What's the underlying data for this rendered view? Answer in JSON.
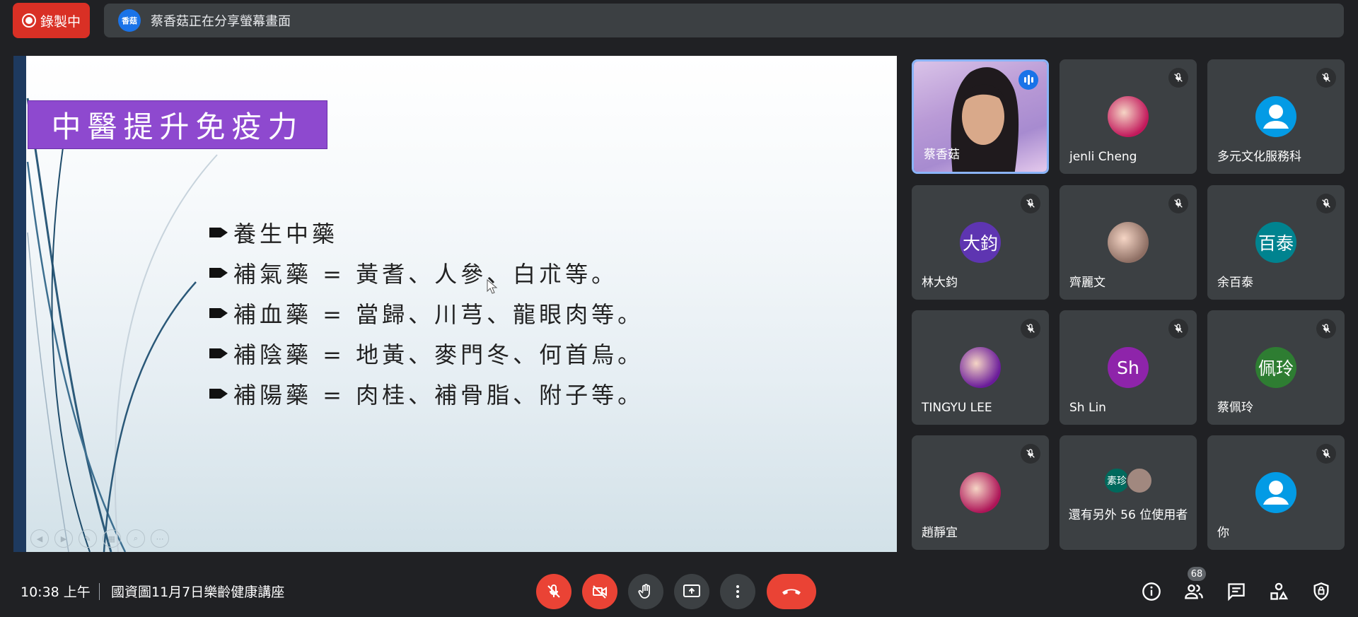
{
  "recording": {
    "label": "錄製中"
  },
  "share_bar": {
    "avatar_text": "香菇",
    "text": "蔡香菇正在分享螢幕畫面"
  },
  "slide": {
    "title": "中醫提升免疫力",
    "bullets": [
      "養生中藥",
      "補氣藥 = 黃耆、人參、白朮等。",
      "補血藥 = 當歸、川芎、龍眼肉等。",
      "補陰藥 = 地黃、麥門冬、何首烏。",
      "補陽藥 = 肉桂、補骨脂、附子等。"
    ]
  },
  "participants": [
    {
      "name": "蔡香菇",
      "state": "speaking",
      "kind": "video"
    },
    {
      "name": "jenli Cheng",
      "state": "muted",
      "kind": "photo",
      "color": "#c2185b"
    },
    {
      "name": "多元文化服務科",
      "state": "muted",
      "kind": "default",
      "color": "#039be5"
    },
    {
      "name": "林大鈞",
      "state": "muted",
      "kind": "letter",
      "letter": "大鈞",
      "color": "#5e35b1"
    },
    {
      "name": "齊麗文",
      "state": "muted",
      "kind": "photo",
      "color": "#8d6e63"
    },
    {
      "name": "余百泰",
      "state": "muted",
      "kind": "letter",
      "letter": "百泰",
      "color": "#00838f"
    },
    {
      "name": "TINGYU LEE",
      "state": "muted",
      "kind": "photo",
      "color": "#6a1b9a"
    },
    {
      "name": "Sh Lin",
      "state": "muted",
      "kind": "letter",
      "letter": "Sh",
      "color": "#8e24aa"
    },
    {
      "name": "蔡佩玲",
      "state": "muted",
      "kind": "letter",
      "letter": "佩玲",
      "color": "#2e7d32"
    },
    {
      "name": "趙靜宜",
      "state": "muted",
      "kind": "photo",
      "color": "#ad1457"
    },
    {
      "name": "還有另外 56 位使用者",
      "state": "none",
      "kind": "more",
      "letter": "素珍",
      "color": "#00695c"
    },
    {
      "name": "你",
      "state": "muted",
      "kind": "default",
      "color": "#039be5"
    }
  ],
  "bottom": {
    "time": "10:38 上午",
    "meeting_title": "國資圖11月7日樂齡健康講座",
    "people_count": "68"
  },
  "icons": {
    "mic": "mic-off-icon",
    "camera": "camera-off-icon",
    "hand": "raise-hand-icon",
    "present": "present-screen-icon",
    "more": "more-vert-icon",
    "end": "end-call-icon",
    "info": "info-icon",
    "people": "people-icon",
    "chat": "chat-icon",
    "activities": "activities-icon",
    "host": "host-controls-icon"
  }
}
